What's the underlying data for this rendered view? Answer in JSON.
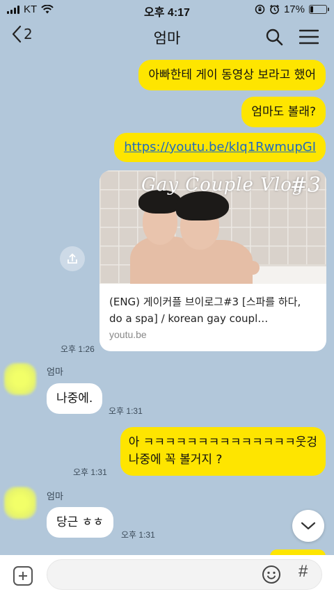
{
  "status_bar": {
    "carrier": "KT",
    "time": "오후 4:17",
    "battery": "17%",
    "battery_level": 0.17
  },
  "header": {
    "back_count": "2",
    "title": "엄마"
  },
  "messages": {
    "m1": "아빠한테 게이 동영상 보라고 했어",
    "m2": "엄마도 볼래?",
    "m3_link": "https://youtu.be/kIq1RwmupGI",
    "card": {
      "thumb_title": "Gay Couple Vlog",
      "thumb_tag": "#3",
      "title": "(ENG) 게이커플 브이로그#3 [스파를 하다, do a spa] / korean gay coupl…",
      "domain": "youtu.be"
    },
    "t1": "오후 1:26",
    "sender1": "엄마",
    "r1": "나중에.",
    "t2": "오후 1:31",
    "m4_line1": "아 ㅋㅋㅋㅋㅋㅋㅋㅋㅋㅋㅋㅋㅋㅋ웃겅",
    "m4_line2": "나중에 꼭 볼거지 ?",
    "t3": "오후 1:31",
    "sender2": "엄마",
    "r2": "당근 ㅎㅎ",
    "t4": "오후 1:31"
  },
  "input": {
    "placeholder": "",
    "hash": "#"
  },
  "colors": {
    "background": "#b2c7da",
    "my_bubble": "#fee500",
    "their_bubble": "#ffffff",
    "link": "#1f6bbf"
  }
}
